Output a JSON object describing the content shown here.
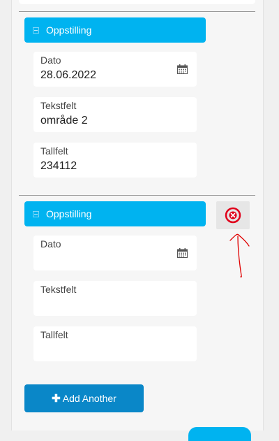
{
  "groups": [
    {
      "header": "Oppstilling",
      "fields": [
        {
          "label": "Dato",
          "value": "28.06.2022"
        },
        {
          "label": "Tekstfelt",
          "value": "område 2"
        },
        {
          "label": "Tallfelt",
          "value": "234112"
        }
      ]
    },
    {
      "header": "Oppstilling",
      "fields": [
        {
          "label": "Dato",
          "value": ""
        },
        {
          "label": "Tekstfelt",
          "value": ""
        },
        {
          "label": "Tallfelt",
          "value": ""
        }
      ]
    }
  ],
  "add_button": {
    "icon": "plus-icon",
    "label": "Add Another"
  },
  "remove_icon": "remove-circle-icon",
  "colors": {
    "header_bg": "#00b3f0",
    "add_button_bg": "#0a87c8",
    "remove_icon": "#e0001b",
    "annotation_arrow": "#e00000"
  }
}
